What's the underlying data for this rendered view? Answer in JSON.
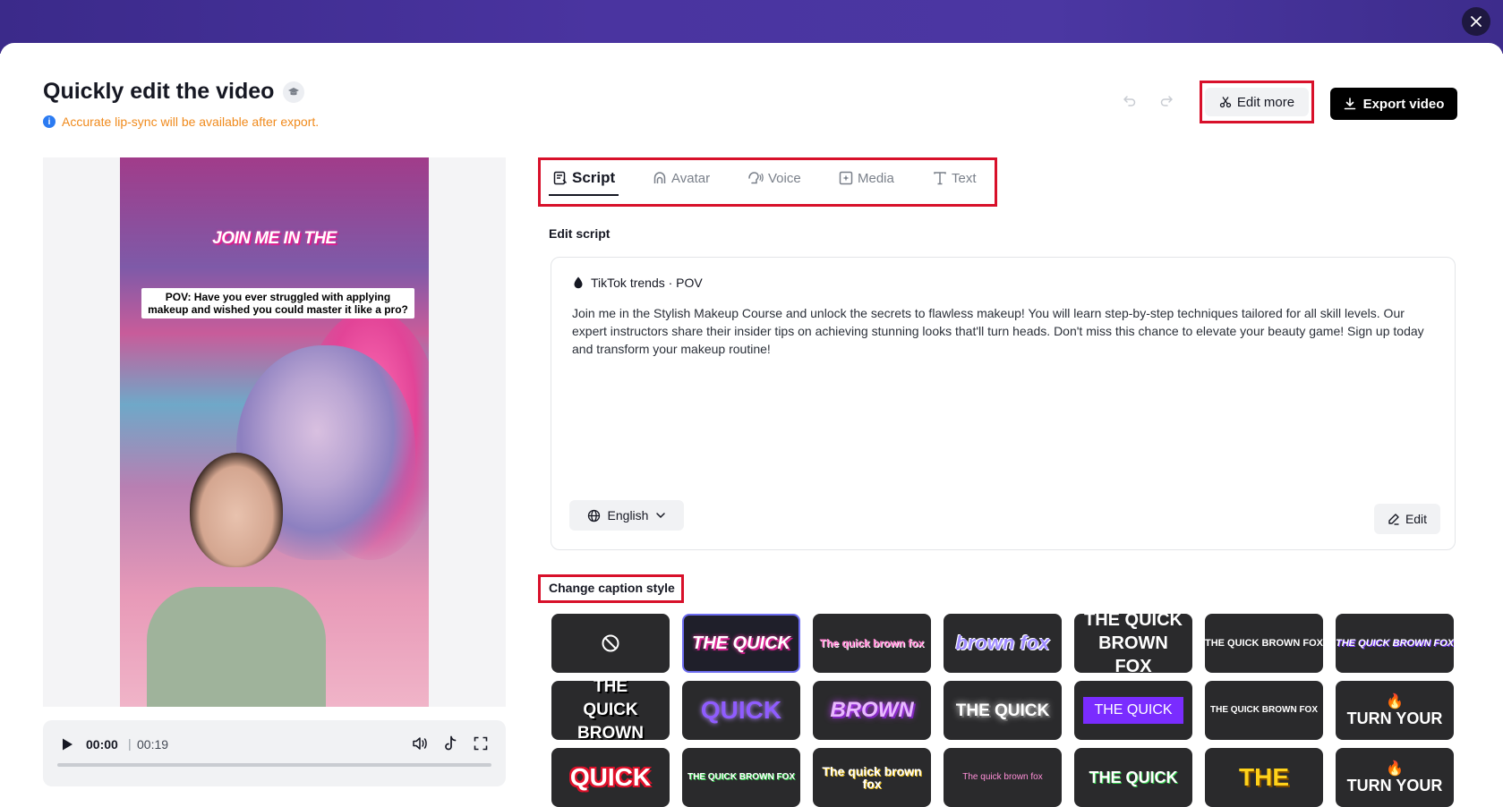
{
  "header": {
    "title": "Quickly edit the video",
    "notice": "Accurate lip-sync will be available after export.",
    "edit_more_label": "Edit more",
    "export_label": "Export video"
  },
  "preview": {
    "hook_text": "JOIN ME IN THE",
    "caption_text": "POV: Have you ever struggled with applying makeup and wished you could master it like a pro?"
  },
  "player": {
    "current_time": "00:00",
    "separator": "|",
    "total_time": "00:19",
    "progress": 0
  },
  "tabs": [
    {
      "label": "Script",
      "active": true
    },
    {
      "label": "Avatar",
      "active": false
    },
    {
      "label": "Voice",
      "active": false
    },
    {
      "label": "Media",
      "active": false
    },
    {
      "label": "Text",
      "active": false
    }
  ],
  "script": {
    "section_label": "Edit script",
    "source": "TikTok trends · POV",
    "text": "Join me in the Stylish Makeup Course and unlock the secrets to flawless makeup! You will learn step-by-step techniques tailored for all skill levels. Our expert instructors share their insider tips on achieving stunning looks that'll turn heads. Don't miss this chance to elevate your beauty game! Sign up today and transform your makeup routine!",
    "language": "English",
    "edit_label": "Edit"
  },
  "captions": {
    "section_label": "Change caption style",
    "styles": [
      {
        "text": "",
        "icon": "none-icon"
      },
      {
        "text": "THE QUICK",
        "selected": true
      },
      {
        "text": "The quick brown fox"
      },
      {
        "text": "brown fox"
      },
      {
        "text": "THE QUICK BROWN FOX"
      },
      {
        "text": "THE QUICK BROWN FOX"
      },
      {
        "text": "THE QUICK BROWN FOX"
      },
      {
        "text": "THE QUICK BROWN"
      },
      {
        "text": "QUICK"
      },
      {
        "text": "BROWN"
      },
      {
        "text": "THE QUICK"
      },
      {
        "text": "THE QUICK"
      },
      {
        "text": "THE QUICK BROWN FOX"
      },
      {
        "text": "TURN YOUR",
        "icon": "fire-icon"
      },
      {
        "text": "QUICK"
      },
      {
        "text": "THE QUICK BROWN FOX"
      },
      {
        "text": "The quick brown fox"
      },
      {
        "text": "The quick brown fox"
      },
      {
        "text": "THE QUICK"
      },
      {
        "text": "THE"
      },
      {
        "text": "TURN YOUR",
        "icon": "fire-icon"
      }
    ]
  }
}
